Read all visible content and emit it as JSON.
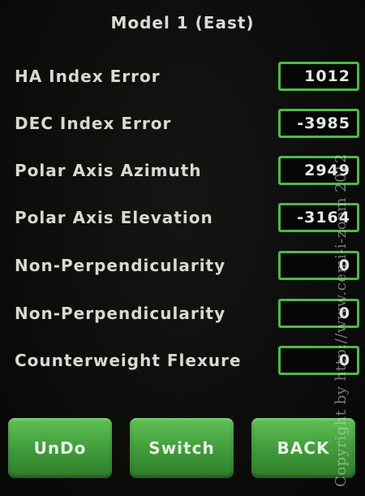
{
  "title": "Model 1 (East)",
  "rows": [
    {
      "label": "HA Index Error",
      "value": "1012"
    },
    {
      "label": "DEC Index Error",
      "value": "-3985"
    },
    {
      "label": "Polar Axis Azimuth",
      "value": "2949"
    },
    {
      "label": "Polar Axis Elevation",
      "value": "-3164"
    },
    {
      "label": "Non-Perpendicularity",
      "value": "0"
    },
    {
      "label": "Non-Perpendicularity",
      "value": "0"
    },
    {
      "label": "Counterweight Flexure",
      "value": "0"
    }
  ],
  "buttons": {
    "undo": "UnDo",
    "switch": "Switch",
    "back": "BACK"
  },
  "watermark": "Copyright by http://www.cemi-i-zoom 2012",
  "colors": {
    "accent": "#4fb84a",
    "button": "#3f9a3a",
    "background": "#0c0d0b",
    "text": "#d6dad0"
  }
}
